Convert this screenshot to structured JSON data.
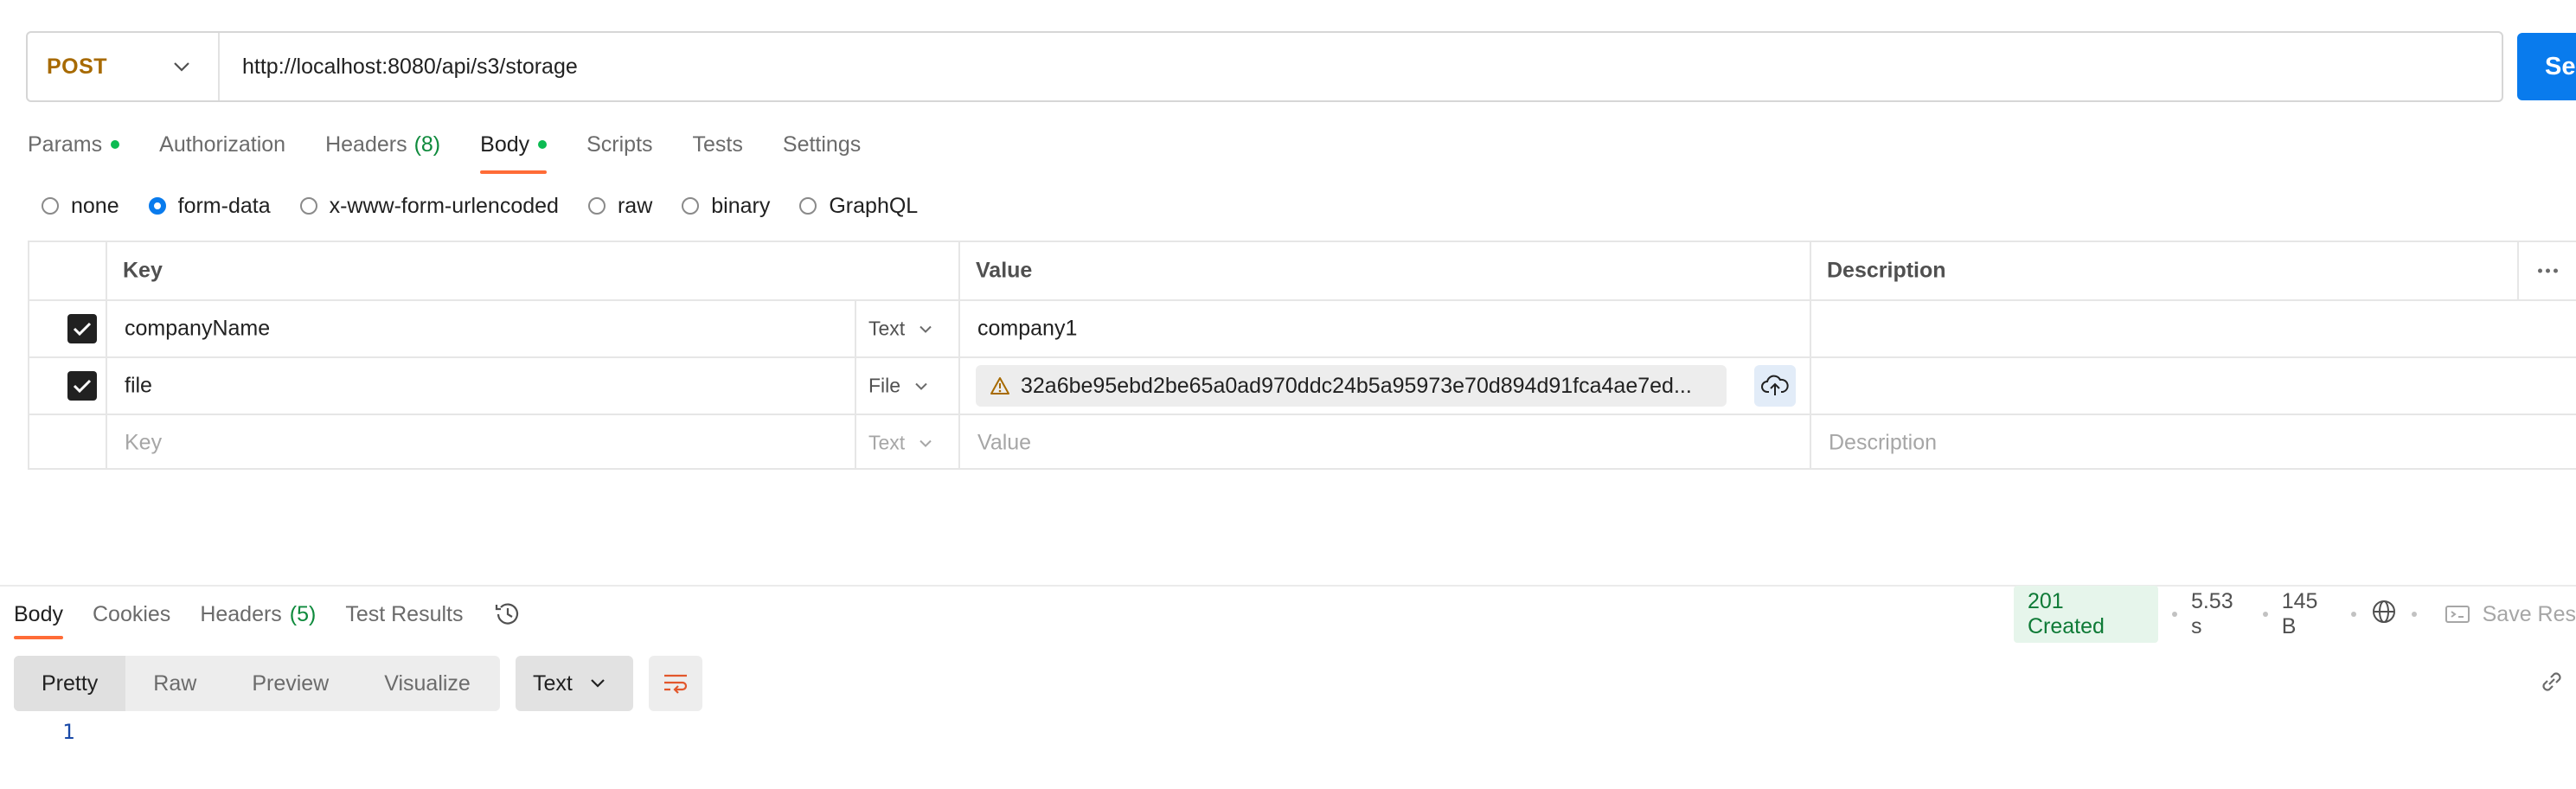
{
  "request": {
    "method": "POST",
    "url": "http://localhost:8080/api/s3/storage",
    "send_label": "Se"
  },
  "tabs": [
    {
      "label": "Params",
      "dot": true
    },
    {
      "label": "Authorization"
    },
    {
      "label": "Headers",
      "count": "(8)"
    },
    {
      "label": "Body",
      "dot": true,
      "active": true
    },
    {
      "label": "Scripts"
    },
    {
      "label": "Tests"
    },
    {
      "label": "Settings"
    }
  ],
  "body_types": [
    {
      "label": "none",
      "checked": false
    },
    {
      "label": "form-data",
      "checked": true
    },
    {
      "label": "x-www-form-urlencoded",
      "checked": false
    },
    {
      "label": "raw",
      "checked": false
    },
    {
      "label": "binary",
      "checked": false
    },
    {
      "label": "GraphQL",
      "checked": false
    }
  ],
  "table": {
    "headers": {
      "key": "Key",
      "value": "Value",
      "description": "Description"
    },
    "rows": [
      {
        "key": "companyName",
        "type": "Text",
        "value": "company1"
      },
      {
        "key": "file",
        "type": "File",
        "value": "32a6be95ebd2be65a0ad970ddc24b5a95973e70d894d91fca4ae7ed..."
      }
    ],
    "placeholder": {
      "key": "Key",
      "type": "Text",
      "value": "Value",
      "description": "Description"
    }
  },
  "response": {
    "tabs": [
      {
        "label": "Body",
        "active": true
      },
      {
        "label": "Cookies"
      },
      {
        "label": "Headers",
        "count": "(5)"
      },
      {
        "label": "Test Results"
      }
    ],
    "status": "201 Created",
    "time": "5.53 s",
    "size": "145 B",
    "save_label": "Save Res",
    "views": [
      "Pretty",
      "Raw",
      "Preview",
      "Visualize"
    ],
    "format": "Text",
    "line_number": "1"
  },
  "colors": {
    "method": "#a76a00",
    "send": "#097bed",
    "accent": "#ff6c37",
    "status_green": "#0e7a36",
    "dot_green": "#0cbb52"
  }
}
